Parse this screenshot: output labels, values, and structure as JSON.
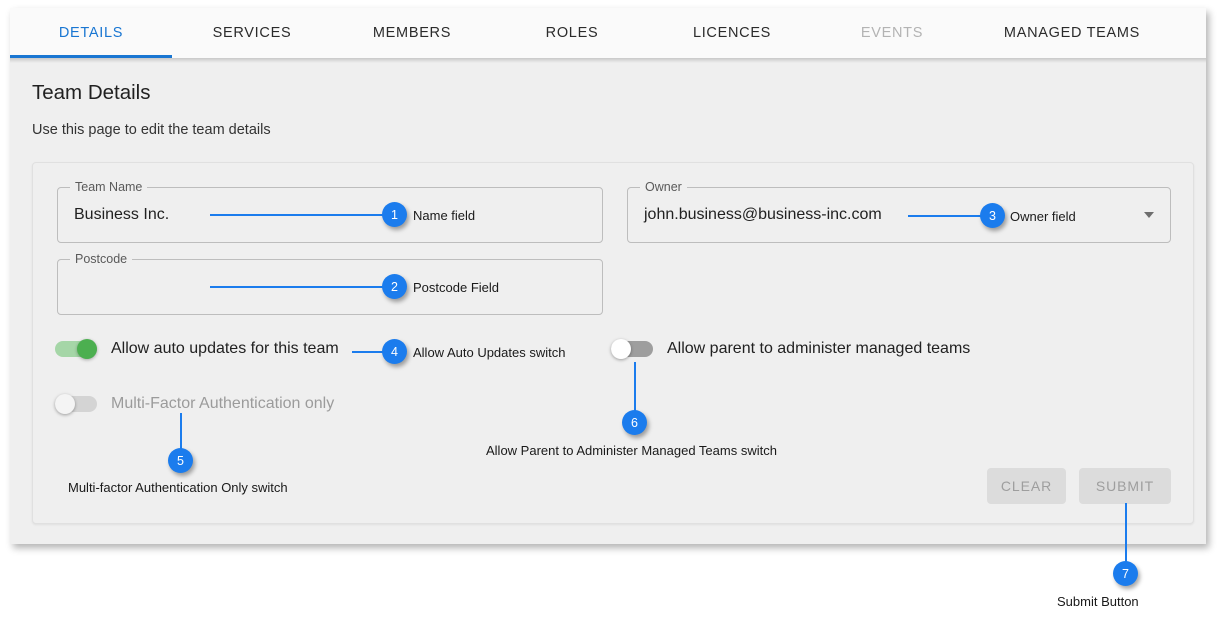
{
  "tabs": [
    {
      "label": "DETAILS",
      "state": "active"
    },
    {
      "label": "SERVICES",
      "state": "normal"
    },
    {
      "label": "MEMBERS",
      "state": "normal"
    },
    {
      "label": "ROLES",
      "state": "normal"
    },
    {
      "label": "LICENCES",
      "state": "normal"
    },
    {
      "label": "EVENTS",
      "state": "disabled"
    },
    {
      "label": "MANAGED TEAMS",
      "state": "normal"
    }
  ],
  "page": {
    "title": "Team Details",
    "subtitle": "Use this page to edit the team details"
  },
  "fields": {
    "team_name": {
      "legend": "Team Name",
      "value": "Business Inc.",
      "placeholder": ""
    },
    "postcode": {
      "legend": "Postcode",
      "value": "",
      "placeholder": ""
    },
    "owner": {
      "legend": "Owner",
      "value": "john.business@business-inc.com",
      "placeholder": "",
      "arrow_icon": "chevron-down-icon"
    }
  },
  "switches": {
    "auto_updates": {
      "label": "Allow auto updates for this team",
      "state": "on"
    },
    "parent_admin": {
      "label": "Allow parent to administer managed teams",
      "state": "off"
    },
    "mfa_only": {
      "label": "Multi-Factor Authentication only",
      "state": "off-disabled"
    }
  },
  "buttons": {
    "clear": "CLEAR",
    "submit": "SUBMIT"
  },
  "callouts": [
    {
      "number": "1",
      "text": "Name field"
    },
    {
      "number": "2",
      "text": "Postcode Field"
    },
    {
      "number": "3",
      "text": "Owner field"
    },
    {
      "number": "4",
      "text": "Allow Auto Updates switch"
    },
    {
      "number": "5",
      "text": "Multi-factor Authentication Only switch"
    },
    {
      "number": "6",
      "text": "Allow Parent to Administer Managed Teams switch"
    },
    {
      "number": "7",
      "text": "Submit Button"
    }
  ],
  "colors": {
    "accent": "#1b7ced",
    "tab_active": "#1976d2",
    "switch_on": "#4caf50",
    "switch_off": "#9e9e9e"
  }
}
